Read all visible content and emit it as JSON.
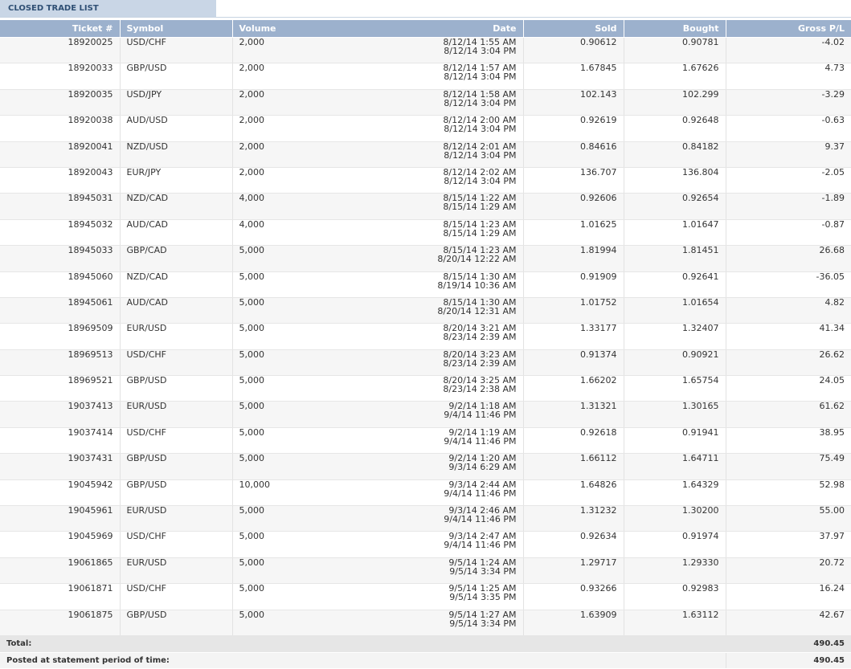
{
  "section": {
    "title": "CLOSED TRADE LIST"
  },
  "table": {
    "headers": {
      "ticket": "Ticket #",
      "symbol": "Symbol",
      "volume": "Volume",
      "date": "Date",
      "sold": "Sold",
      "bought": "Bought",
      "gross_pl": "Gross P/L"
    },
    "rows": [
      {
        "ticket": "18920025",
        "symbol": "USD/CHF",
        "volume": "2,000",
        "date_open": "8/12/14 1:55 AM",
        "date_close": "8/12/14 3:04 PM",
        "sold": "0.90612",
        "bought": "0.90781",
        "first": "sold",
        "gross_pl": "-4.02"
      },
      {
        "ticket": "18920033",
        "symbol": "GBP/USD",
        "volume": "2,000",
        "date_open": "8/12/14 1:57 AM",
        "date_close": "8/12/14 3:04 PM",
        "sold": "1.67845",
        "bought": "1.67626",
        "first": "sold",
        "gross_pl": "4.73"
      },
      {
        "ticket": "18920035",
        "symbol": "USD/JPY",
        "volume": "2,000",
        "date_open": "8/12/14 1:58 AM",
        "date_close": "8/12/14 3:04 PM",
        "sold": "102.143",
        "bought": "102.299",
        "first": "sold",
        "gross_pl": "-3.29"
      },
      {
        "ticket": "18920038",
        "symbol": "AUD/USD",
        "volume": "2,000",
        "date_open": "8/12/14 2:00 AM",
        "date_close": "8/12/14 3:04 PM",
        "sold": "0.92619",
        "bought": "0.92648",
        "first": "sold",
        "gross_pl": "-0.63"
      },
      {
        "ticket": "18920041",
        "symbol": "NZD/USD",
        "volume": "2,000",
        "date_open": "8/12/14 2:01 AM",
        "date_close": "8/12/14 3:04 PM",
        "sold": "0.84616",
        "bought": "0.84182",
        "first": "sold",
        "gross_pl": "9.37"
      },
      {
        "ticket": "18920043",
        "symbol": "EUR/JPY",
        "volume": "2,000",
        "date_open": "8/12/14 2:02 AM",
        "date_close": "8/12/14 3:04 PM",
        "sold": "136.707",
        "bought": "136.804",
        "first": "sold",
        "gross_pl": "-2.05"
      },
      {
        "ticket": "18945031",
        "symbol": "NZD/CAD",
        "volume": "4,000",
        "date_open": "8/15/14 1:22 AM",
        "date_close": "8/15/14 1:29 AM",
        "sold": "0.92606",
        "bought": "0.92654",
        "first": "bought",
        "gross_pl": "-1.89"
      },
      {
        "ticket": "18945032",
        "symbol": "AUD/CAD",
        "volume": "4,000",
        "date_open": "8/15/14 1:23 AM",
        "date_close": "8/15/14 1:29 AM",
        "sold": "1.01625",
        "bought": "1.01647",
        "first": "bought",
        "gross_pl": "-0.87"
      },
      {
        "ticket": "18945033",
        "symbol": "GBP/CAD",
        "volume": "5,000",
        "date_open": "8/15/14 1:23 AM",
        "date_close": "8/20/14 12:22 AM",
        "sold": "1.81994",
        "bought": "1.81451",
        "first": "sold",
        "gross_pl": "26.68"
      },
      {
        "ticket": "18945060",
        "symbol": "NZD/CAD",
        "volume": "5,000",
        "date_open": "8/15/14 1:30 AM",
        "date_close": "8/19/14 10:36 AM",
        "sold": "0.91909",
        "bought": "0.92641",
        "first": "bought",
        "gross_pl": "-36.05"
      },
      {
        "ticket": "18945061",
        "symbol": "AUD/CAD",
        "volume": "5,000",
        "date_open": "8/15/14 1:30 AM",
        "date_close": "8/20/14 12:31 AM",
        "sold": "1.01752",
        "bought": "1.01654",
        "first": "bought",
        "gross_pl": "4.82"
      },
      {
        "ticket": "18969509",
        "symbol": "EUR/USD",
        "volume": "5,000",
        "date_open": "8/20/14 3:21 AM",
        "date_close": "8/23/14 2:39 AM",
        "sold": "1.33177",
        "bought": "1.32407",
        "first": "sold",
        "gross_pl": "41.34"
      },
      {
        "ticket": "18969513",
        "symbol": "USD/CHF",
        "volume": "5,000",
        "date_open": "8/20/14 3:23 AM",
        "date_close": "8/23/14 2:39 AM",
        "sold": "0.91374",
        "bought": "0.90921",
        "first": "bought",
        "gross_pl": "26.62"
      },
      {
        "ticket": "18969521",
        "symbol": "GBP/USD",
        "volume": "5,000",
        "date_open": "8/20/14 3:25 AM",
        "date_close": "8/23/14 2:38 AM",
        "sold": "1.66202",
        "bought": "1.65754",
        "first": "sold",
        "gross_pl": "24.05"
      },
      {
        "ticket": "19037413",
        "symbol": "EUR/USD",
        "volume": "5,000",
        "date_open": "9/2/14 1:18 AM",
        "date_close": "9/4/14 11:46 PM",
        "sold": "1.31321",
        "bought": "1.30165",
        "first": "sold",
        "gross_pl": "61.62"
      },
      {
        "ticket": "19037414",
        "symbol": "USD/CHF",
        "volume": "5,000",
        "date_open": "9/2/14 1:19 AM",
        "date_close": "9/4/14 11:46 PM",
        "sold": "0.92618",
        "bought": "0.91941",
        "first": "bought",
        "gross_pl": "38.95"
      },
      {
        "ticket": "19037431",
        "symbol": "GBP/USD",
        "volume": "5,000",
        "date_open": "9/2/14 1:20 AM",
        "date_close": "9/3/14 6:29 AM",
        "sold": "1.66112",
        "bought": "1.64711",
        "first": "sold",
        "gross_pl": "75.49"
      },
      {
        "ticket": "19045942",
        "symbol": "GBP/USD",
        "volume": "10,000",
        "date_open": "9/3/14 2:44 AM",
        "date_close": "9/4/14 11:46 PM",
        "sold": "1.64826",
        "bought": "1.64329",
        "first": "sold",
        "gross_pl": "52.98"
      },
      {
        "ticket": "19045961",
        "symbol": "EUR/USD",
        "volume": "5,000",
        "date_open": "9/3/14 2:46 AM",
        "date_close": "9/4/14 11:46 PM",
        "sold": "1.31232",
        "bought": "1.30200",
        "first": "sold",
        "gross_pl": "55.00"
      },
      {
        "ticket": "19045969",
        "symbol": "USD/CHF",
        "volume": "5,000",
        "date_open": "9/3/14 2:47 AM",
        "date_close": "9/4/14 11:46 PM",
        "sold": "0.92634",
        "bought": "0.91974",
        "first": "bought",
        "gross_pl": "37.97"
      },
      {
        "ticket": "19061865",
        "symbol": "EUR/USD",
        "volume": "5,000",
        "date_open": "9/5/14 1:24 AM",
        "date_close": "9/5/14 3:34 PM",
        "sold": "1.29717",
        "bought": "1.29330",
        "first": "sold",
        "gross_pl": "20.72"
      },
      {
        "ticket": "19061871",
        "symbol": "USD/CHF",
        "volume": "5,000",
        "date_open": "9/5/14 1:25 AM",
        "date_close": "9/5/14 3:35 PM",
        "sold": "0.93266",
        "bought": "0.92983",
        "first": "bought",
        "gross_pl": "16.24"
      },
      {
        "ticket": "19061875",
        "symbol": "GBP/USD",
        "volume": "5,000",
        "date_open": "9/5/14 1:27 AM",
        "date_close": "9/5/14 3:34 PM",
        "sold": "1.63909",
        "bought": "1.63112",
        "first": "sold",
        "gross_pl": "42.67"
      }
    ],
    "total": {
      "label": "Total:",
      "value": "490.45"
    },
    "posted": {
      "label": "Posted at statement period of time:",
      "value": "490.45"
    }
  }
}
